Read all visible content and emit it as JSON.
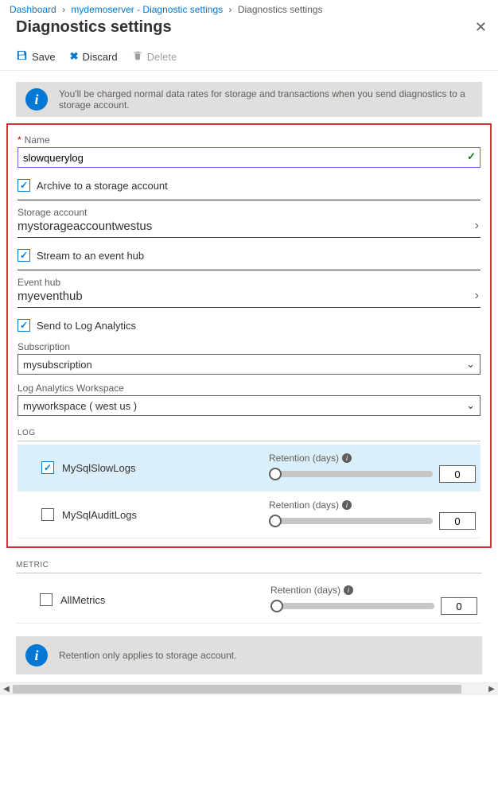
{
  "breadcrumb": {
    "dashboard": "Dashboard",
    "server": "mydemoserver - Diagnostic settings",
    "current": "Diagnostics settings"
  },
  "title": "Diagnostics settings",
  "toolbar": {
    "save": "Save",
    "discard": "Discard",
    "delete": "Delete"
  },
  "banner_rates": "You'll be charged normal data rates for storage and transactions when you send diagnostics to a storage account.",
  "form": {
    "name_label": "Name",
    "name_value": "slowquerylog",
    "archive_label": "Archive to a storage account",
    "storage_label": "Storage account",
    "storage_value": "mystorageaccountwestus",
    "stream_label": "Stream to an event hub",
    "eventhub_label": "Event hub",
    "eventhub_value": "myeventhub",
    "sendla_label": "Send to Log Analytics",
    "subscription_label": "Subscription",
    "subscription_value": "mysubscription",
    "workspace_label": "Log Analytics Workspace",
    "workspace_value": "myworkspace ( west us )"
  },
  "sections": {
    "log": "LOG",
    "metric": "METRIC",
    "retention_label": "Retention (days)"
  },
  "logs": [
    {
      "name": "MySqlSlowLogs",
      "checked": true,
      "retention": "0",
      "selected": true
    },
    {
      "name": "MySqlAuditLogs",
      "checked": false,
      "retention": "0",
      "selected": false
    }
  ],
  "metrics": [
    {
      "name": "AllMetrics",
      "checked": false,
      "retention": "0"
    }
  ],
  "banner_retention": "Retention only applies to storage account."
}
